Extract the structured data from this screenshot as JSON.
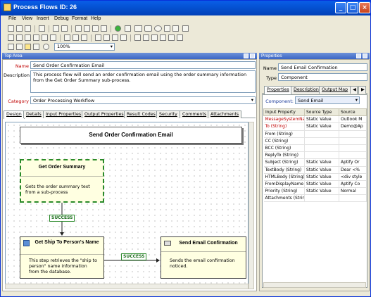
{
  "window": {
    "title": "Process Flows ID: 26",
    "min": "_",
    "max": "□",
    "close": "×"
  },
  "menu": [
    "File",
    "View",
    "Insert",
    "Debug",
    "Format",
    "Help"
  ],
  "zoom": {
    "value": "100%"
  },
  "top_area": {
    "header": "Top Area",
    "name_label": "Name",
    "name_value": "Send Order Confirmation Email",
    "description_label": "Description",
    "description_value": "This process flow will send an order confirmation email using the order summary information from the Get Order Summary sub-process.",
    "category_label": "Category",
    "category_value": "Order Processing Workflow"
  },
  "tabs": [
    "Design",
    "Details",
    "Input Properties",
    "Output Properties",
    "Result Codes",
    "Security",
    "Comments",
    "Attachments"
  ],
  "canvas": {
    "header": "Send Order Confirmation Email",
    "nodes": [
      {
        "title": "Get Order Summary",
        "desc": "Gets the order summary text from a sub-process"
      },
      {
        "title": "Get Ship To Person's Name",
        "desc": "This step retrieves the \"ship to person\" name information from the database."
      },
      {
        "title": "Send Email Confirmation",
        "desc": "Sends the email confirmation noticed."
      }
    ],
    "success_label": "SUCCESS"
  },
  "properties": {
    "header": "Properties",
    "name_label": "Name",
    "name_value": "Send Email Confirmation",
    "type_label": "Type",
    "type_value": "Component",
    "tabs": [
      "Properties",
      "Description",
      "Output Map"
    ],
    "component_label": "Component:",
    "component_value": "Send Email",
    "columns": [
      "Input Property",
      "Source Type",
      "Source"
    ],
    "rows": [
      [
        "MessageSystemNa",
        "Static Value",
        "Outlook M"
      ],
      [
        "To (String)",
        "Static Value",
        "Demo@Ap"
      ],
      [
        "From (String)",
        "",
        ""
      ],
      [
        "CC (String)",
        "",
        ""
      ],
      [
        "BCC (String)",
        "",
        ""
      ],
      [
        "ReplyTo (String)",
        "",
        ""
      ],
      [
        "Subject (String)",
        "Static Value",
        "Aptify Or"
      ],
      [
        "TextBody (String)",
        "Static Value",
        "Dear <%"
      ],
      [
        "HTMLBody (String)",
        "Static Value",
        "<div style"
      ],
      [
        "FromDisplayName (",
        "Static Value",
        "Aptify Co"
      ],
      [
        "Priority (String)",
        "Static Value",
        "Normal"
      ],
      [
        "Attachments (Strin",
        "",
        ""
      ]
    ]
  },
  "colors": {
    "title_blue": "#0553d4",
    "panel_blue": "#3b66c4",
    "required_red": "#c00000",
    "success_green": "#2a8a2a"
  }
}
